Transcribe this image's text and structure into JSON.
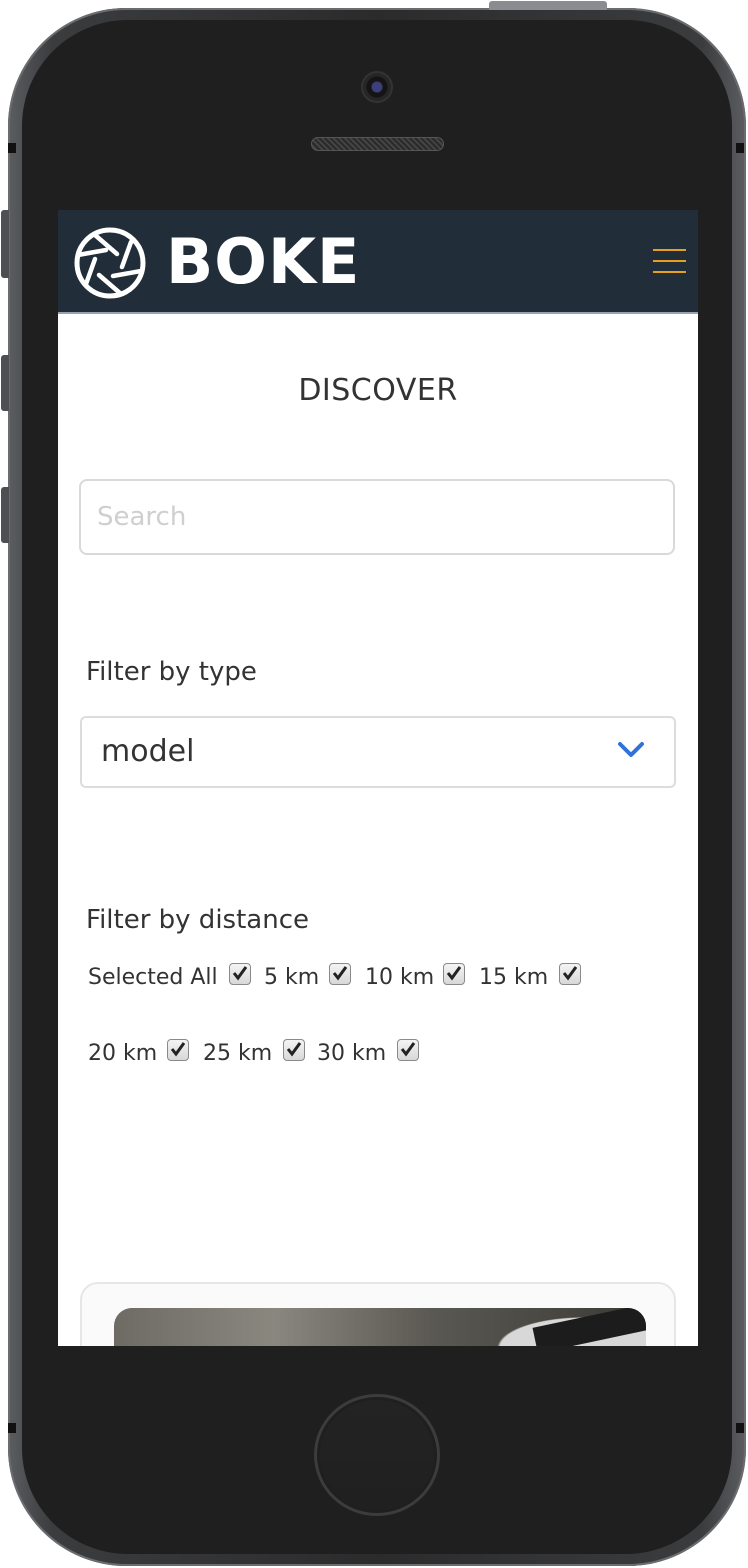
{
  "app": {
    "brand": "BOKE",
    "accent_color": "#e7a01e",
    "navbar_color": "#222d3a"
  },
  "navbar": {
    "logo_icon": "aperture-icon",
    "menu_icon": "hamburger-menu-icon"
  },
  "page": {
    "title": "DISCOVER"
  },
  "search": {
    "placeholder": "Search",
    "value": ""
  },
  "filter_type": {
    "label": "Filter by type",
    "selected": "model",
    "dropdown_icon": "chevron-down-icon"
  },
  "filter_distance": {
    "label": "Filter by distance",
    "options": [
      {
        "label": "Selected All",
        "checked": true
      },
      {
        "label": "5 km",
        "checked": true
      },
      {
        "label": "10 km",
        "checked": true
      },
      {
        "label": "15 km",
        "checked": true
      },
      {
        "label": "20 km",
        "checked": true
      },
      {
        "label": "25 km",
        "checked": true
      },
      {
        "label": "30 km",
        "checked": true
      }
    ]
  }
}
